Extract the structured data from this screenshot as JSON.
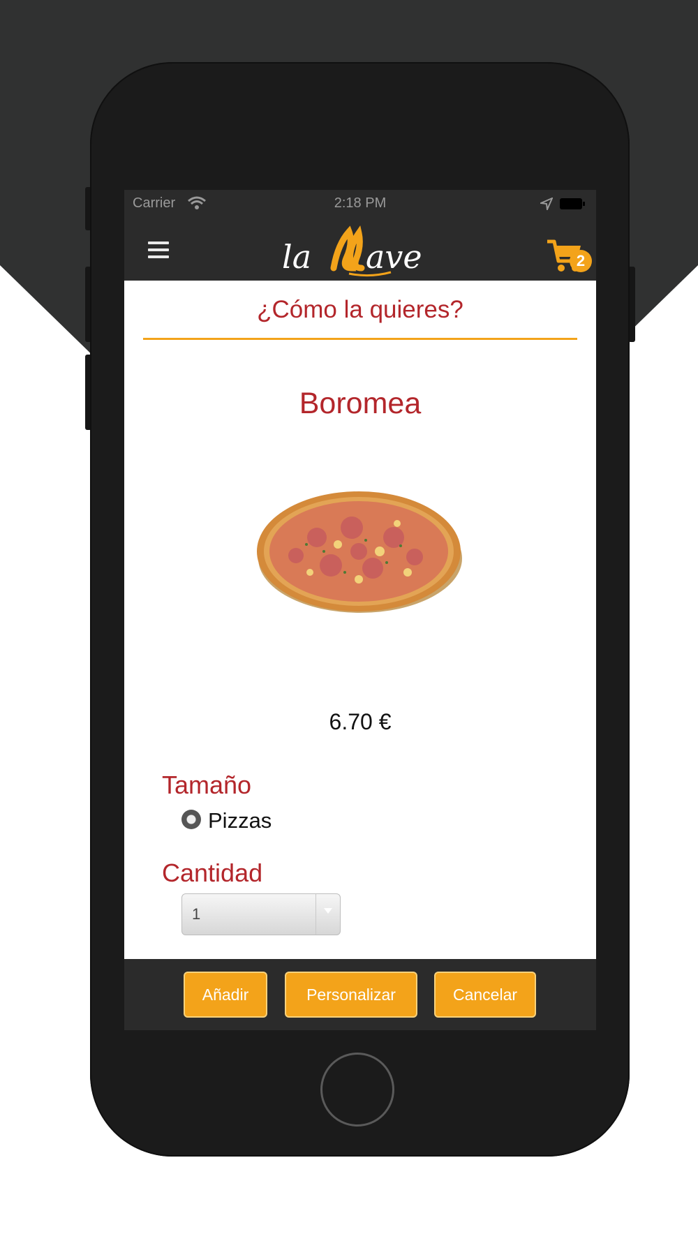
{
  "colors": {
    "accent": "#f3a31a",
    "heading_red": "#b3262b",
    "bar_dark": "#2b2b2b",
    "phone_body": "#1b1b1b",
    "background_hex": "#303131"
  },
  "status_bar": {
    "carrier": "Carrier",
    "time": "2:18 PM",
    "icons": [
      "wifi-icon",
      "location-icon",
      "battery-icon"
    ]
  },
  "header": {
    "logo_text": "la Llave",
    "menu_icon": "menu-icon",
    "cart_icon": "cart-icon",
    "cart_count": "2"
  },
  "page": {
    "title": "¿Cómo la quieres?",
    "product_name": "Boromea",
    "price": "6.70 €",
    "size_label": "Tamaño",
    "size_options": [
      {
        "label": "Pizzas",
        "selected": true
      }
    ],
    "quantity_label": "Cantidad",
    "quantity_value": "1"
  },
  "actions": {
    "add": "Añadir",
    "customize": "Personalizar",
    "cancel": "Cancelar"
  }
}
